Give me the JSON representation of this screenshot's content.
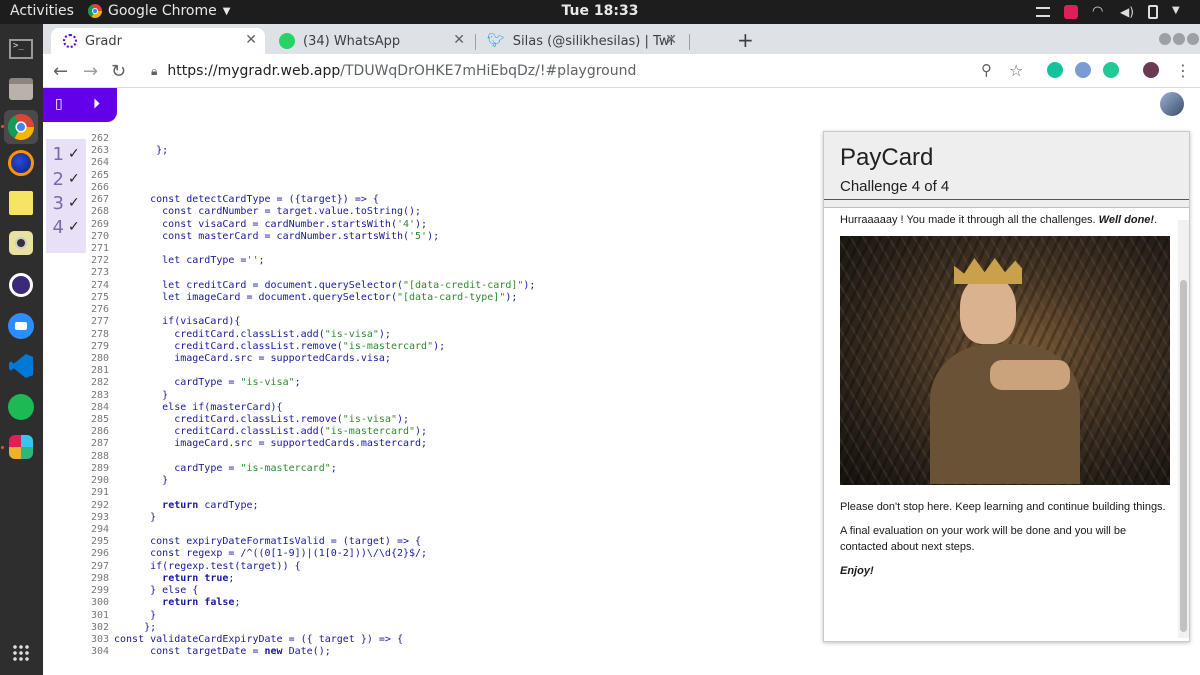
{
  "os": {
    "activities": "Activities",
    "app": "Google Chrome",
    "clock": "Tue 18:33"
  },
  "tabs": [
    {
      "title": "Gradr",
      "active": true
    },
    {
      "title": "(34) WhatsApp",
      "active": false
    },
    {
      "title": "Silas (@silikhesilas) | Twit",
      "active": false
    }
  ],
  "address": {
    "host": "https://mygradr.web.app",
    "path": "/TDUWqDrOHKE7mHiEbqDz/!#playground"
  },
  "checklist": [
    {
      "num": "1",
      "mark": "✓"
    },
    {
      "num": "2",
      "mark": "✓"
    },
    {
      "num": "3",
      "mark": "✓"
    },
    {
      "num": "4",
      "mark": "✓"
    }
  ],
  "code": [
    {
      "n": "262",
      "t": ""
    },
    {
      "n": "263",
      "t": "       };"
    },
    {
      "n": "264",
      "t": ""
    },
    {
      "n": "265",
      "t": ""
    },
    {
      "n": "266",
      "t": ""
    },
    {
      "n": "267",
      "t": "      const detectCardType = ({target}) => {"
    },
    {
      "n": "268",
      "t": "        const cardNumber = target.value.toString();"
    },
    {
      "n": "269",
      "t": "        const visaCard = cardNumber.startsWith('4');"
    },
    {
      "n": "270",
      "t": "        const masterCard = cardNumber.startsWith('5');"
    },
    {
      "n": "271",
      "t": ""
    },
    {
      "n": "272",
      "t": "        let cardType ='';"
    },
    {
      "n": "273",
      "t": ""
    },
    {
      "n": "274",
      "t": "        let creditCard = document.querySelector(\"[data-credit-card]\");"
    },
    {
      "n": "275",
      "t": "        let imageCard = document.querySelector(\"[data-card-type]\");"
    },
    {
      "n": "276",
      "t": ""
    },
    {
      "n": "277",
      "t": "        if(visaCard){"
    },
    {
      "n": "278",
      "t": "          creditCard.classList.add(\"is-visa\");"
    },
    {
      "n": "279",
      "t": "          creditCard.classList.remove(\"is-mastercard\");"
    },
    {
      "n": "280",
      "t": "          imageCard.src = supportedCards.visa;"
    },
    {
      "n": "281",
      "t": ""
    },
    {
      "n": "282",
      "t": "          cardType = \"is-visa\";"
    },
    {
      "n": "283",
      "t": "        }"
    },
    {
      "n": "284",
      "t": "        else if(masterCard){"
    },
    {
      "n": "285",
      "t": "          creditCard.classList.remove(\"is-visa\");"
    },
    {
      "n": "286",
      "t": "          creditCard.classList.add(\"is-mastercard\");"
    },
    {
      "n": "287",
      "t": "          imageCard.src = supportedCards.mastercard;"
    },
    {
      "n": "288",
      "t": ""
    },
    {
      "n": "289",
      "t": "          cardType = \"is-mastercard\";"
    },
    {
      "n": "290",
      "t": "        }"
    },
    {
      "n": "291",
      "t": ""
    },
    {
      "n": "292",
      "t": "        return cardType;"
    },
    {
      "n": "293",
      "t": "      }"
    },
    {
      "n": "294",
      "t": ""
    },
    {
      "n": "295",
      "t": "      const expiryDateFormatIsValid = (target) => {"
    },
    {
      "n": "296",
      "t": "      const regexp = /^((0[1-9])|(1[0-2]))\\/\\d{2}$/;"
    },
    {
      "n": "297",
      "t": "      if(regexp.test(target)) {"
    },
    {
      "n": "298",
      "t": "        return true;"
    },
    {
      "n": "299",
      "t": "      } else {"
    },
    {
      "n": "300",
      "t": "        return false;"
    },
    {
      "n": "301",
      "t": "      }"
    },
    {
      "n": "302",
      "t": "     };"
    },
    {
      "n": "303",
      "t": "const validateCardExpiryDate = ({ target }) => {"
    },
    {
      "n": "304",
      "t": "      const targetDate = new Date();"
    }
  ],
  "paycard": {
    "title": "PayCard",
    "subtitle": "Challenge 4 of 4",
    "msg1": "Hurraaaaay ! You made it through all the challenges. ",
    "msg1_bold": "Well done!",
    "msg1_end": ".",
    "msg2": "Please don't stop here. Keep learning and continue building things.",
    "msg3": "A final evaluation on your work will be done and you will be contacted about next steps.",
    "msg4": "Enjoy!"
  },
  "colors": {
    "gradr_purple": "#6200ea",
    "check_bg": "#e8e0f7"
  }
}
